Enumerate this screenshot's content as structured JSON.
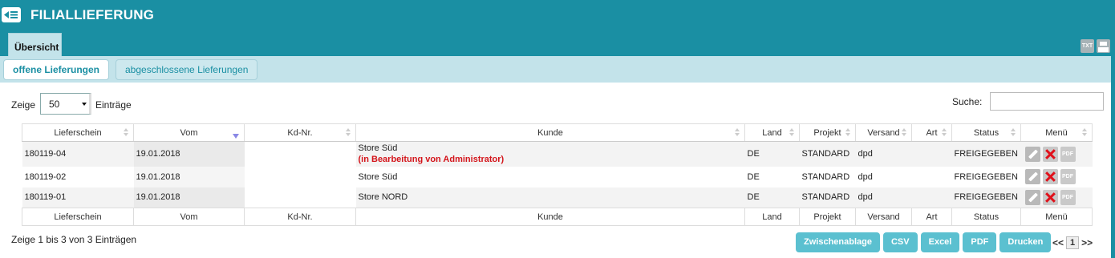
{
  "header": {
    "title": "FILIALLIEFERUNG",
    "back_icon": "back-menu-icon"
  },
  "main_tab": {
    "label": "Übersicht"
  },
  "top_icons": {
    "txt_label": "TXT",
    "print_icon": "print-icon"
  },
  "subtabs": [
    {
      "label": "offene Lieferungen",
      "active": true
    },
    {
      "label": "abgeschlossene Lieferungen",
      "active": false
    }
  ],
  "length": {
    "prefix": "Zeige",
    "value": "50",
    "suffix": "Einträge"
  },
  "search": {
    "label": "Suche:",
    "value": ""
  },
  "columns": [
    "Lieferschein",
    "Vom",
    "Kd-Nr.",
    "Kunde",
    "Land",
    "Projekt",
    "Versand",
    "Art",
    "Status",
    "Menü"
  ],
  "rows": [
    {
      "lieferschein": "180119-04",
      "vom": "19.01.2018",
      "kdnr": "",
      "kunde": "Store Süd",
      "note": "(in Bearbeitung von Administrator)",
      "land": "DE",
      "projekt": "STANDARD",
      "versand": "dpd",
      "art": "",
      "status": "FREIGEGEBEN"
    },
    {
      "lieferschein": "180119-02",
      "vom": "19.01.2018",
      "kdnr": "",
      "kunde": "Store Süd",
      "note": "",
      "land": "DE",
      "projekt": "STANDARD",
      "versand": "dpd",
      "art": "",
      "status": "FREIGEGEBEN"
    },
    {
      "lieferschein": "180119-01",
      "vom": "19.01.2018",
      "kdnr": "",
      "kunde": "Store NORD",
      "note": "",
      "land": "DE",
      "projekt": "STANDARD",
      "versand": "dpd",
      "art": "",
      "status": "FREIGEGEBEN"
    }
  ],
  "row_actions": {
    "edit_icon": "edit-icon",
    "delete_icon": "delete-icon",
    "pdf_label": "PDF"
  },
  "info": "Zeige 1 bis 3 von 3 Einträgen",
  "export_buttons": [
    "Zwischenablage",
    "CSV",
    "Excel",
    "PDF",
    "Drucken"
  ],
  "pager": {
    "prev": "<<",
    "current": "1",
    "next": ">>"
  },
  "colors": {
    "header": "#1a8fa3",
    "tabbar": "#c3e3ea",
    "button": "#5bc0d0",
    "lock_note": "#d4151b"
  }
}
